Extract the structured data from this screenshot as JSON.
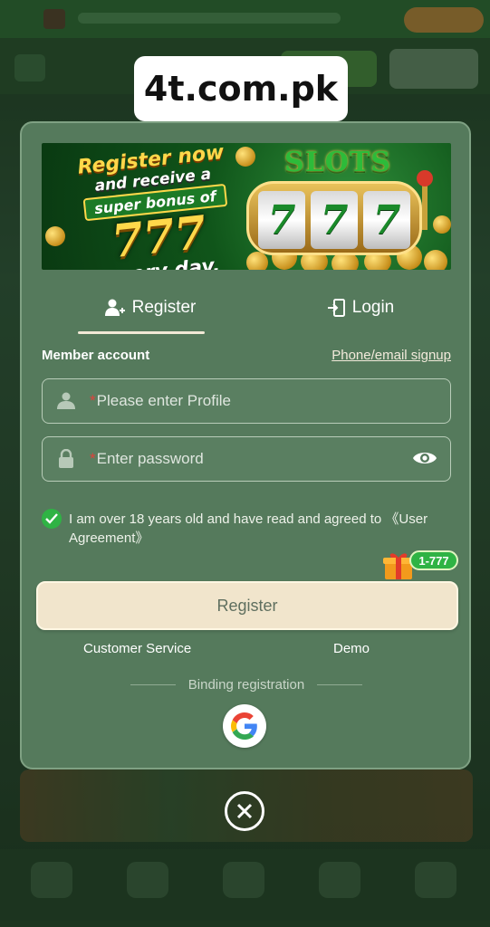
{
  "watermark": {
    "text": "4t.com.pk"
  },
  "banner": {
    "line1": "Register now",
    "line2": "and receive a",
    "line3": "super bonus of",
    "amount": "777",
    "line4": "every day.",
    "slots_title": "SLOTS",
    "reels": [
      "7",
      "7",
      "7"
    ]
  },
  "tabs": [
    {
      "label": "Register",
      "icon": "add-user-icon",
      "active": true
    },
    {
      "label": "Login",
      "icon": "login-door-icon",
      "active": false
    }
  ],
  "form": {
    "member_account_label": "Member account",
    "phone_email_link": "Phone/email signup",
    "profile_placeholder": "Please enter Profile",
    "password_placeholder": "Enter password",
    "required_mark": "*",
    "agreement_text": "I am over 18 years old and have read and agreed to 《User Agreement》",
    "agreement_checked": true,
    "bonus_badge": "1-777",
    "register_button": "Register"
  },
  "links": {
    "customer_service": "Customer Service",
    "demo": "Demo"
  },
  "binding": {
    "label": "Binding registration",
    "google_icon": "google-icon"
  },
  "colors": {
    "modal_bg": "#557a5c",
    "accent_green": "#2fb344",
    "button_bg": "#f1e5cc",
    "required_red": "#e0413b"
  }
}
